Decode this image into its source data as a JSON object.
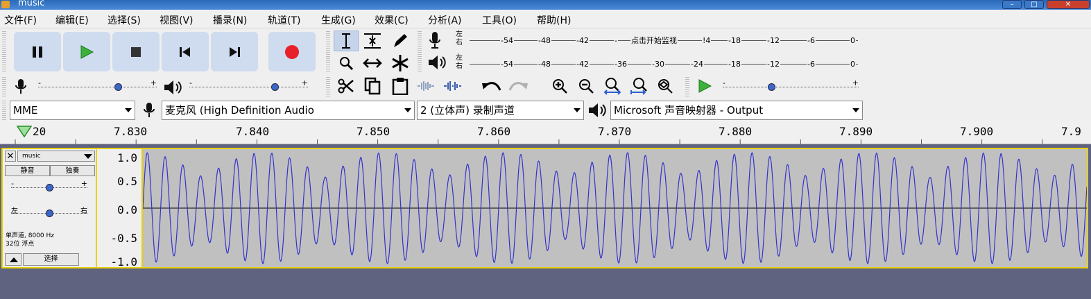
{
  "window": {
    "title": "music",
    "minimize": "–",
    "maximize": "□",
    "close": "✕"
  },
  "menu": [
    "文件(F)",
    "编辑(E)",
    "选择(S)",
    "视图(V)",
    "播录(N)",
    "轨道(T)",
    "生成(G)",
    "效果(C)",
    "分析(A)",
    "工具(O)",
    "帮助(H)"
  ],
  "meters": {
    "record_ticks": [
      "-54",
      "-48",
      "-42",
      "-",
      "-18",
      "-12",
      "-6",
      "0"
    ],
    "record_hint": "点击开始监视",
    "record_hint_suffix": "!4",
    "play_ticks": [
      "-54",
      "-48",
      "-42",
      "-36",
      "-30",
      "-24",
      "-18",
      "-12",
      "-6",
      "0"
    ],
    "left": "左",
    "right": "右"
  },
  "mixer": {
    "minus": "-",
    "plus": "+",
    "record_volume": 0.69,
    "play_volume": 0.74,
    "speed": 0.35
  },
  "device": {
    "host": "MME",
    "input": "麦克风 (High Definition Audio",
    "channels": "2 (立体声) 录制声道",
    "output": "Microsoft 声音映射器 - Output"
  },
  "ruler": {
    "labels": [
      "20",
      "7.830",
      "7.840",
      "7.850",
      "7.860",
      "7.870",
      "7.880",
      "7.890",
      "7.900",
      "7.9"
    ]
  },
  "track": {
    "name": "music",
    "mute": "静音",
    "solo": "独奏",
    "gain_minus": "-",
    "gain_plus": "+",
    "gain": 0.5,
    "pan_left": "左",
    "pan_right": "右",
    "pan": 0.5,
    "info_line1": "单声道, 8000 Hz",
    "info_line2": "32位 浮点",
    "select": "选择"
  },
  "scale": {
    "labels": [
      "1.0",
      "0.5",
      "0.0",
      "-0.5",
      "-1.0"
    ]
  },
  "colors": {
    "waveform": "#3333cc",
    "selected_border": "#e6d200",
    "record": "#e8202a",
    "play": "#2a9a2a"
  }
}
